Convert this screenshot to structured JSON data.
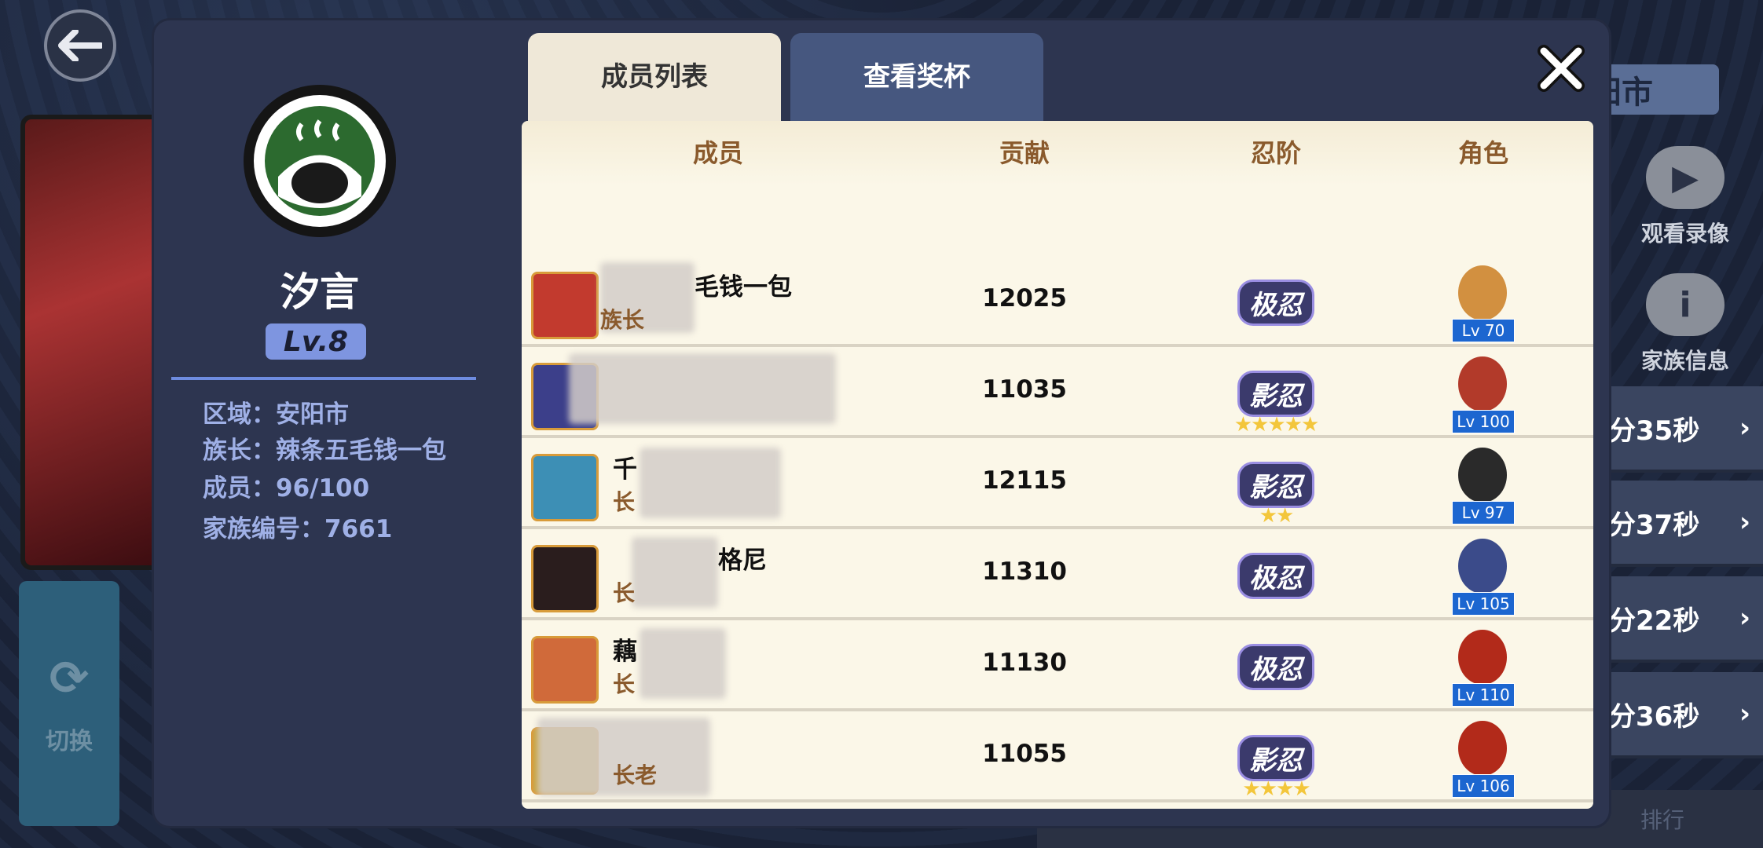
{
  "background": {
    "right_tab": "阳市",
    "side_buttons": [
      {
        "icon": "video-replay-icon",
        "label": "观看录像"
      },
      {
        "icon": "info-icon",
        "label": "家族信息"
      }
    ],
    "timers": [
      "分35秒",
      "分37秒",
      "分22秒",
      "分36秒"
    ],
    "switch_label": "切换",
    "bottom_label": "排行"
  },
  "family": {
    "name": "汐言",
    "level": "Lv.8",
    "info": {
      "region": "区域：安阳市",
      "leader": "族长：辣条五毛钱一包",
      "members": "成员：96/100",
      "family_id": "家族编号：7661"
    }
  },
  "tabs": [
    {
      "label": "成员列表",
      "active": true
    },
    {
      "label": "查看奖杯",
      "active": false
    }
  ],
  "table": {
    "headers": {
      "member": "成员",
      "contribution": "贡献",
      "rank": "忍阶",
      "character": "角色"
    },
    "rows": [
      {
        "name": "毛钱一包",
        "role": "族长",
        "contribution": "12025",
        "rank": "极忍",
        "stars": "",
        "character_level": "Lv 70",
        "avatar_color": "#c23a2e",
        "char_color": "#d29040"
      },
      {
        "name": "",
        "role": "",
        "contribution": "11035",
        "rank": "影忍",
        "stars": "★★★★★",
        "character_level": "Lv 100",
        "avatar_color": "#3c3f8a",
        "char_color": "#b23a2a"
      },
      {
        "name": "千",
        "role": "长",
        "contribution": "12115",
        "rank": "影忍",
        "stars": "★★",
        "character_level": "Lv 97",
        "avatar_color": "#3d8fb5",
        "char_color": "#2a2a2a"
      },
      {
        "name": "格尼",
        "role": "长",
        "contribution": "11310",
        "rank": "极忍",
        "stars": "",
        "character_level": "Lv 105",
        "avatar_color": "#2a1d1d",
        "char_color": "#3b4b8a"
      },
      {
        "name": "藕",
        "role": "长",
        "contribution": "11130",
        "rank": "极忍",
        "stars": "",
        "character_level": "Lv 110",
        "avatar_color": "#d06a3a",
        "char_color": "#b22a1a"
      },
      {
        "name": "",
        "role": "长老",
        "contribution": "11055",
        "rank": "影忍",
        "stars": "★★★★",
        "character_level": "Lv 106",
        "avatar_color": "#c9a23a",
        "char_color": "#b22a1a"
      }
    ]
  },
  "colors": {
    "panel": "#2d3550",
    "table_bg": "#fbf7e8",
    "header_text": "#8a5a2c",
    "info_text": "#9fb0e6",
    "level_badge": "#7e95e0",
    "level_tag": "#1c66d0"
  }
}
